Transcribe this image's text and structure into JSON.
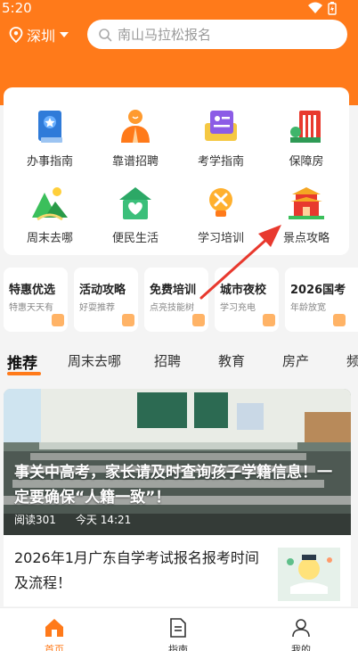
{
  "status": {
    "time": "5:20"
  },
  "header": {
    "city": "深圳",
    "search_placeholder": "南山马拉松报名"
  },
  "grid": [
    {
      "label": "办事指南",
      "icon": "guide-book-icon"
    },
    {
      "label": "靠谱招聘",
      "icon": "recruit-person-icon"
    },
    {
      "label": "考学指南",
      "icon": "exam-card-icon"
    },
    {
      "label": "保障房",
      "icon": "housing-building-icon"
    },
    {
      "label": "周末去哪",
      "icon": "mountain-weekend-icon"
    },
    {
      "label": "便民生活",
      "icon": "heart-house-icon"
    },
    {
      "label": "学习培训",
      "icon": "bulb-tools-icon"
    },
    {
      "label": "景点攻略",
      "icon": "temple-attraction-icon"
    }
  ],
  "promos": [
    {
      "title": "特惠优选",
      "sub": "特惠天天有"
    },
    {
      "title": "活动攻略",
      "sub": "好耍推荐"
    },
    {
      "title": "免费培训",
      "sub": "点亮技能树"
    },
    {
      "title": "城市夜校",
      "sub": "学习充电"
    },
    {
      "title": "2026国考",
      "sub": "年龄放宽"
    }
  ],
  "tabs": [
    "推荐",
    "周末去哪",
    "招聘",
    "教育",
    "房产",
    "频"
  ],
  "feature": {
    "title": "事关中高考，家长请及时查询孩子学籍信息！一定要确保“人籍一致”！",
    "reads": "阅读301",
    "time": "今天 14:21"
  },
  "article": {
    "title": "2026年1月广东自学考试报名报考时间及流程！"
  },
  "nav": [
    {
      "label": "首页",
      "icon": "home-icon"
    },
    {
      "label": "指南",
      "icon": "document-icon"
    },
    {
      "label": "我的",
      "icon": "user-icon"
    }
  ],
  "colors": {
    "accent": "#ff7a1a",
    "arrow": "#e8392e"
  }
}
